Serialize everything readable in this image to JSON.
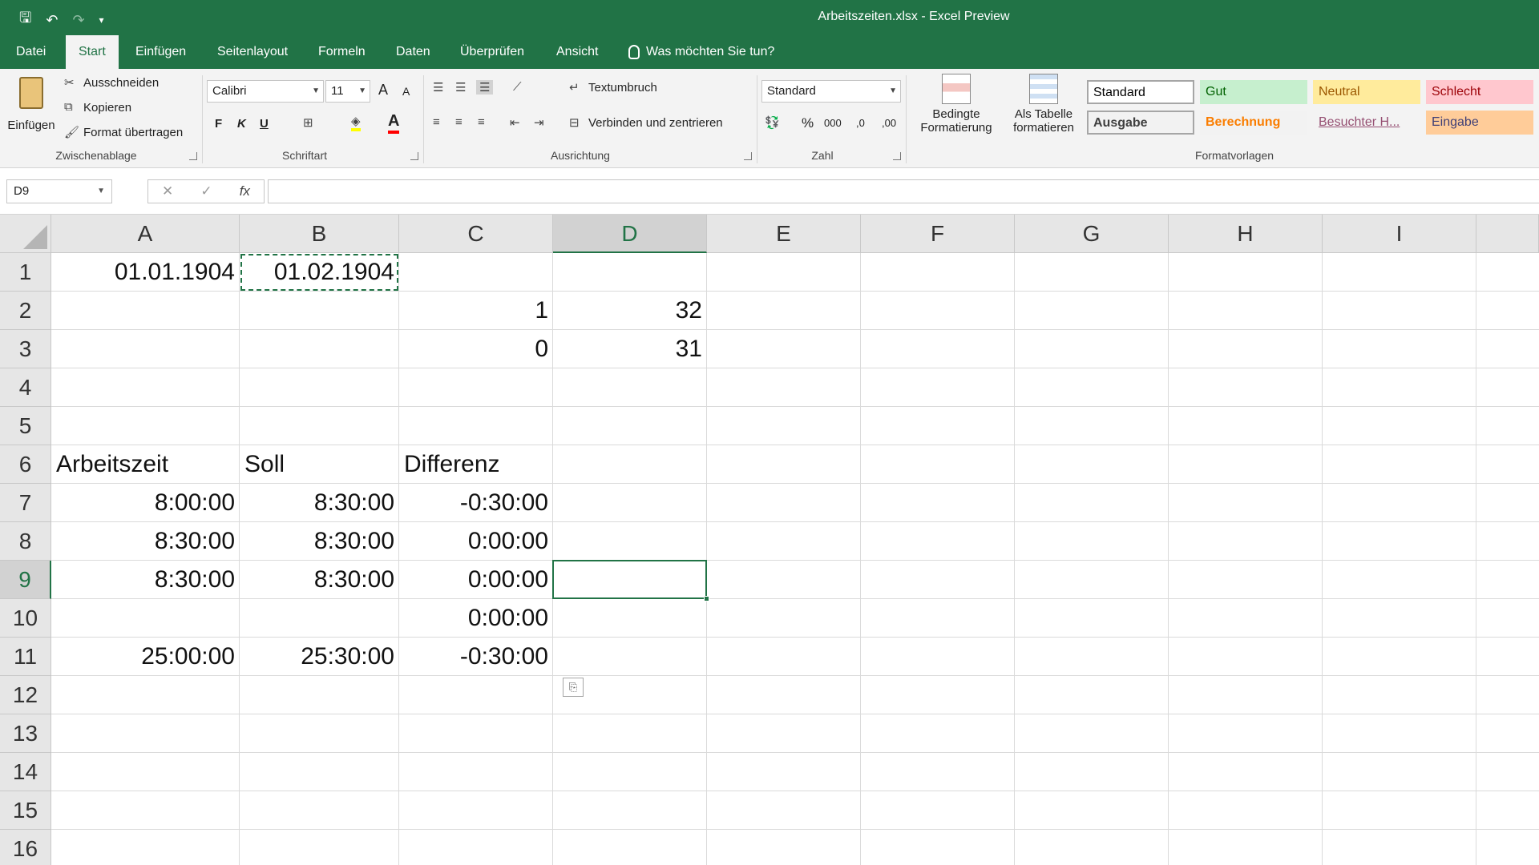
{
  "window": {
    "title": "Arbeitszeiten.xlsx  -  Excel Preview"
  },
  "qat": {
    "save": "🖫",
    "undo": "↶",
    "redo": "↷",
    "more": "▾"
  },
  "tabs": [
    {
      "label": "Datei"
    },
    {
      "label": "Start"
    },
    {
      "label": "Einfügen"
    },
    {
      "label": "Seitenlayout"
    },
    {
      "label": "Formeln"
    },
    {
      "label": "Daten"
    },
    {
      "label": "Überprüfen"
    },
    {
      "label": "Ansicht"
    }
  ],
  "tell_me": "Was möchten Sie tun?",
  "ribbon": {
    "clipboard": {
      "paste": "Einfügen",
      "cut": "Ausschneiden",
      "copy": "Kopieren",
      "format_painter": "Format übertragen",
      "group": "Zwischenablage"
    },
    "font": {
      "name": "Calibri",
      "size": "11",
      "bold": "F",
      "italic": "K",
      "underline": "U",
      "grow": "A",
      "shrink": "A",
      "group": "Schriftart"
    },
    "alignment": {
      "wrap": "Textumbruch",
      "merge": "Verbinden und zentrieren",
      "group": "Ausrichtung"
    },
    "number": {
      "format": "Standard",
      "percent": "%",
      "thousands": "000",
      "inc_dec": ",0",
      "dec_dec": ",00",
      "group": "Zahl"
    },
    "cond_format": {
      "line1": "Bedingte",
      "line2": "Formatierung"
    },
    "as_table": {
      "line1": "Als Tabelle",
      "line2": "formatieren"
    },
    "styles": {
      "group": "Formatvorlagen",
      "items": [
        {
          "label": "Standard",
          "bg": "#ffffff",
          "fg": "#000000"
        },
        {
          "label": "Gut",
          "bg": "#c6efce",
          "fg": "#006100"
        },
        {
          "label": "Neutral",
          "bg": "#ffeb9c",
          "fg": "#9c5700"
        },
        {
          "label": "Schlecht",
          "bg": "#ffc7ce",
          "fg": "#9c0006"
        },
        {
          "label": "Ausgabe",
          "bg": "#f2f2f2",
          "fg": "#3f3f3f"
        },
        {
          "label": "Berechnung",
          "bg": "#f2f2f2",
          "fg": "#fa7d00"
        },
        {
          "label": "Besuchter H...",
          "bg": "#f3f3f3",
          "fg": "#954f72"
        },
        {
          "label": "Eingabe",
          "bg": "#ffcc99",
          "fg": "#3f3f76"
        }
      ]
    }
  },
  "formula_bar": {
    "name_box": "D9",
    "cancel": "✕",
    "enter": "✓",
    "fx": "fx",
    "content": ""
  },
  "columns": [
    "A",
    "B",
    "C",
    "D",
    "E",
    "F",
    "G",
    "H",
    "I"
  ],
  "rows": [
    "1",
    "2",
    "3",
    "4",
    "5",
    "6",
    "7",
    "8",
    "9",
    "10",
    "11",
    "12",
    "13",
    "14",
    "15",
    "16"
  ],
  "cells": {
    "A1": "01.01.1904",
    "B1": "01.02.1904",
    "C2": "1",
    "D2": "32",
    "C3": "0",
    "D3": "31",
    "A6": "Arbeitszeit",
    "B6": "Soll",
    "C6": "Differenz",
    "A7": "8:00:00",
    "B7": "8:30:00",
    "C7": "-0:30:00",
    "A8": "8:30:00",
    "B8": "8:30:00",
    "C8": "0:00:00",
    "A9": "8:30:00",
    "B9": "8:30:00",
    "C9": "0:00:00",
    "C10": "0:00:00",
    "A11": "25:00:00",
    "B11": "25:30:00",
    "C11": "-0:30:00"
  },
  "selection": {
    "active": "D9",
    "copy_source": "B1"
  },
  "colors": {
    "accent": "#217346",
    "ribbon_bg": "#f3f3f3",
    "header_bg": "#e6e6e6"
  }
}
